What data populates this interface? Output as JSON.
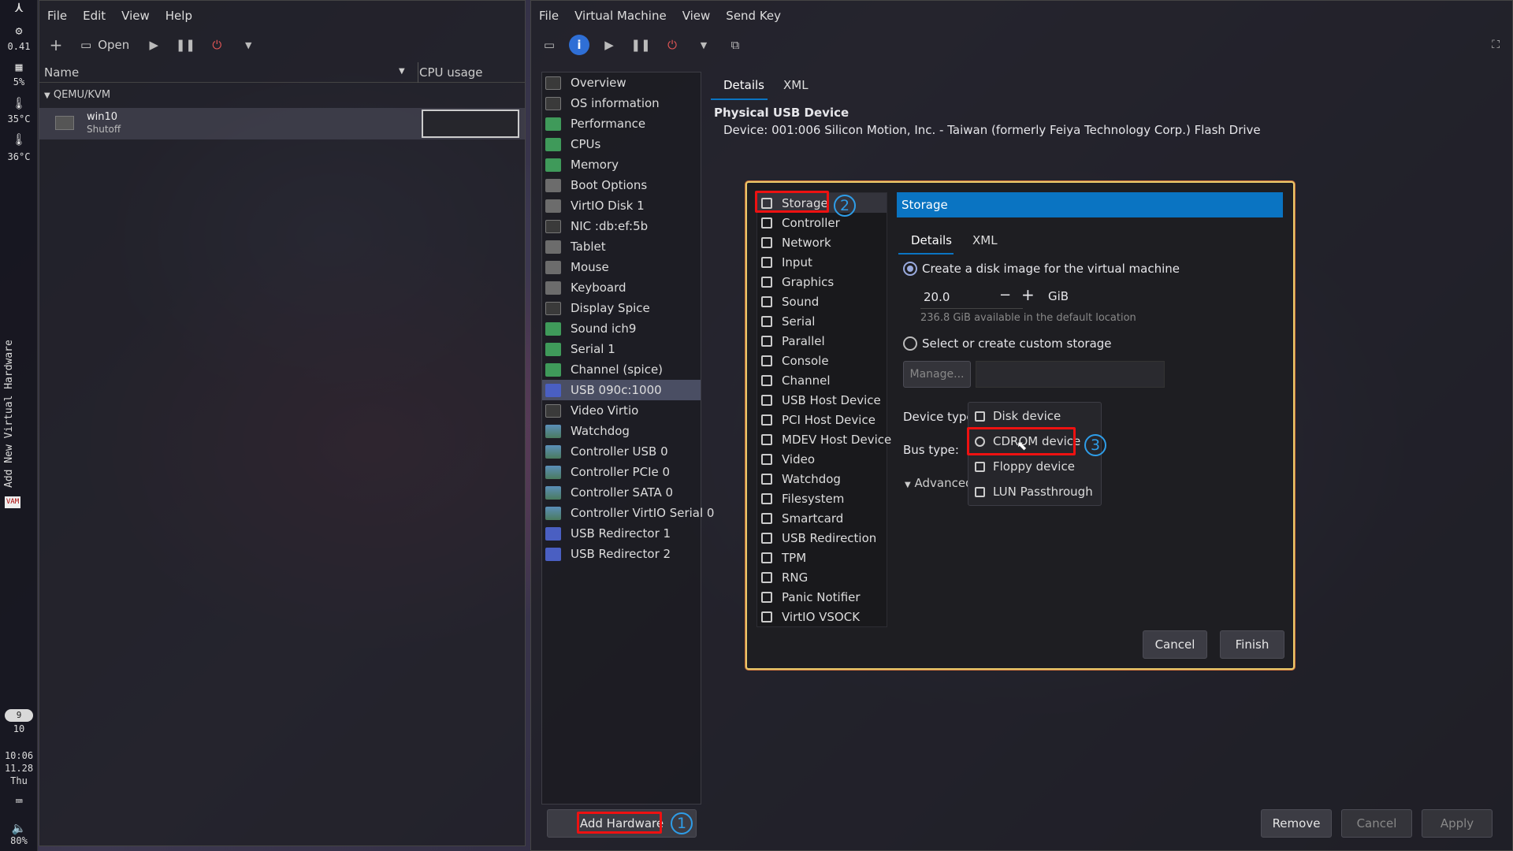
{
  "dock": {
    "cpu_load": "0.41",
    "mem": "5%",
    "temp1": "35°C",
    "temp2": "36°C",
    "vertical_label": "Add New Virtual Hardware",
    "workspace_current": "9",
    "workspace_total": "10",
    "time": "10:06",
    "date": "11.28",
    "weekday": "Thu",
    "volume": "80%",
    "vm_badge": "VAM"
  },
  "manager": {
    "menu": [
      "File",
      "Edit",
      "View",
      "Help"
    ],
    "open_label": "Open",
    "col_name": "Name",
    "col_cpu": "CPU usage",
    "group": "QEMU/KVM",
    "vm_name": "win10",
    "vm_status": "Shutoff"
  },
  "vm_window": {
    "menu": [
      "File",
      "Virtual Machine",
      "View",
      "Send Key"
    ],
    "hardware": [
      "Overview",
      "OS information",
      "Performance",
      "CPUs",
      "Memory",
      "Boot Options",
      "VirtIO Disk 1",
      "NIC :db:ef:5b",
      "Tablet",
      "Mouse",
      "Keyboard",
      "Display Spice",
      "Sound ich9",
      "Serial 1",
      "Channel (spice)",
      "USB 090c:1000",
      "Video Virtio",
      "Watchdog",
      "Controller USB 0",
      "Controller PCIe 0",
      "Controller SATA 0",
      "Controller VirtIO Serial 0",
      "USB Redirector 1",
      "USB Redirector 2"
    ],
    "selected_hw": "USB 090c:1000",
    "tab_details": "Details",
    "tab_xml": "XML",
    "section_title": "Physical USB Device",
    "device_line": "Device:  001:006 Silicon Motion, Inc. - Taiwan (formerly Feiya Technology Corp.) Flash Drive",
    "add_hardware": "Add Hardware",
    "remove": "Remove",
    "cancel": "Cancel",
    "apply": "Apply"
  },
  "dialog": {
    "types": [
      "Storage",
      "Controller",
      "Network",
      "Input",
      "Graphics",
      "Sound",
      "Serial",
      "Parallel",
      "Console",
      "Channel",
      "USB Host Device",
      "PCI Host Device",
      "MDEV Host Device",
      "Video",
      "Watchdog",
      "Filesystem",
      "Smartcard",
      "USB Redirection",
      "TPM",
      "RNG",
      "Panic Notifier",
      "VirtIO VSOCK"
    ],
    "selected": "Storage",
    "header": "Storage",
    "tab_details": "Details",
    "tab_xml": "XML",
    "opt_create": "Create a disk image for the virtual machine",
    "size": "20.0",
    "unit": "GiB",
    "available": "236.8 GiB available in the default location",
    "opt_custom": "Select or create custom storage",
    "manage": "Manage...",
    "device_type_label": "Device type:",
    "bus_type_label": "Bus type:",
    "advanced": "Advanced o",
    "device_options": [
      "Disk device",
      "CDROM device",
      "Floppy device",
      "LUN Passthrough"
    ],
    "selected_device": "CDROM device",
    "cancel": "Cancel",
    "finish": "Finish"
  },
  "annotations": [
    "1",
    "2",
    "3"
  ],
  "colors": {
    "accent": "#0a74c2",
    "annotation_red": "#ee1111",
    "annotation_blue": "#2e9de8"
  }
}
